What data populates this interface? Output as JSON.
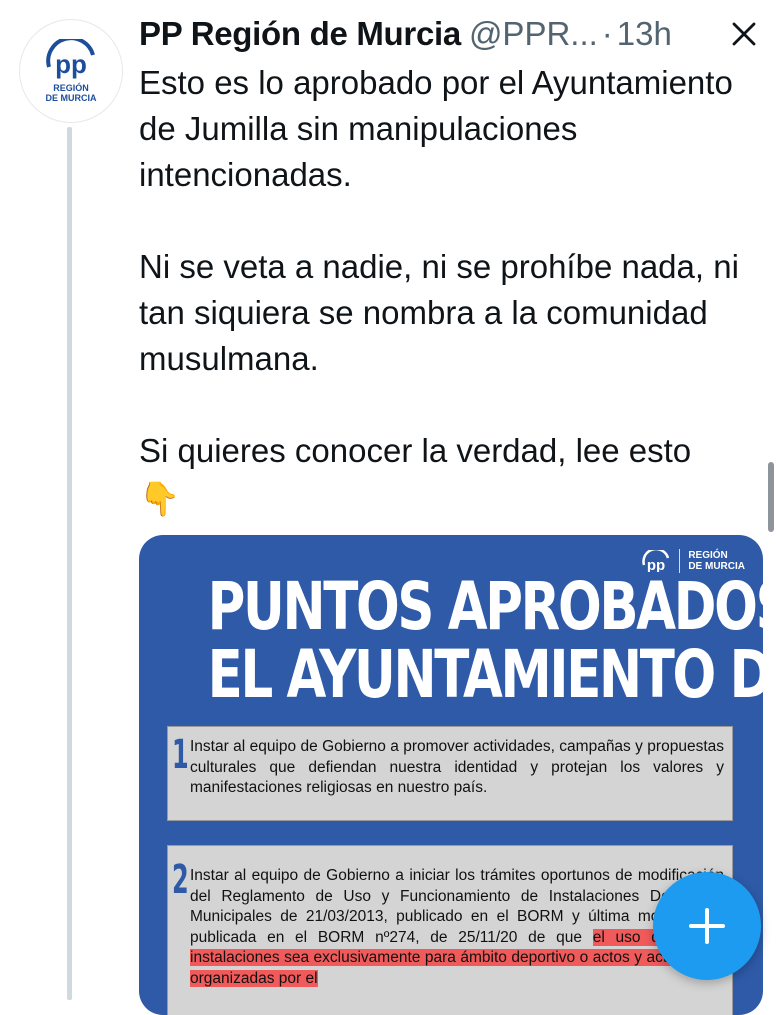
{
  "tweet": {
    "author_name": "PP Región de Murcia",
    "handle": "@PPR...",
    "separator": "·",
    "time": "13h",
    "avatar_brand_line1": "REGIÓN",
    "avatar_brand_line2": "DE MURCIA",
    "avatar_logo_text": "pp",
    "paragraph1": "Esto es lo aprobado por el Ayuntamiento de Jumilla sin manipulaciones intencionadas.",
    "paragraph2": "Ni se veta a nadie, ni se prohíbe nada, ni tan siquiera se nombra a la comunidad musulmana.",
    "paragraph3": "Si quieres conocer la verdad, lee esto",
    "emoji": "👇"
  },
  "media": {
    "logo_text": "pp",
    "logo_line1": "REGIÓN",
    "logo_line2": "DE MURCIA",
    "title_line1": "PUNTOS APROBADOS POR",
    "title_line2": "EL AYUNTAMIENTO DE JUMILLA",
    "point1_number": "1",
    "point1_text": "Instar al equipo de Gobierno a promover actividades, campañas y propuestas culturales que defiendan nuestra identidad y protejan los valores y manifestaciones religiosas en nuestro país.",
    "point2_number": "2",
    "point2_text_a": "Instar al equipo de Gobierno a iniciar los trámites oportunos de modificación del Reglamento de Uso y Funcionamiento de Instalaciones Deportivas Municipales de 21/03/2013, publicado en el BORM y última modificación publicada en el BORM nº274, de 25/11/20",
    "point2_text_b": " de que ",
    "point2_text_hl": "el uso de dichas instalaciones sea exclusivamente para ámbito deportivo o actos y actividades organizadas por el",
    "colors": {
      "background": "#2e5aa8",
      "panel": "#d4d4d4",
      "highlight": "#f05a5a"
    }
  },
  "fab": {
    "label": "+",
    "color": "#1d9bf0"
  },
  "close": {
    "label": "×"
  }
}
